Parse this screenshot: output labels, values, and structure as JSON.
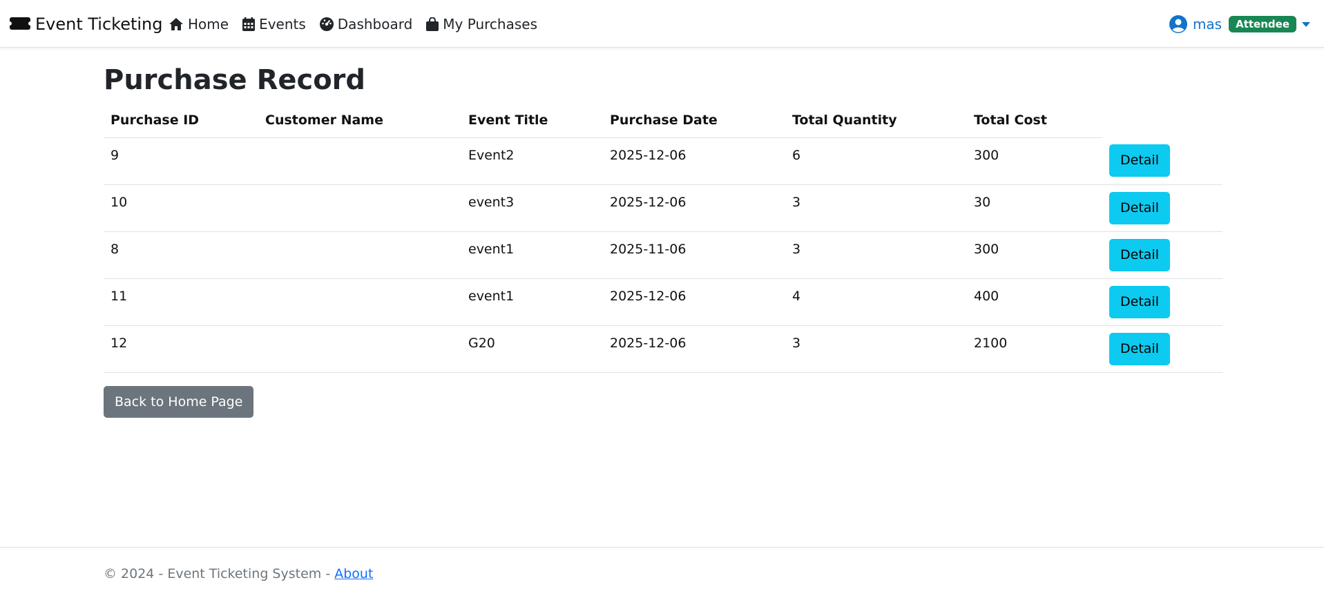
{
  "navbar": {
    "brand": "Event Ticketing",
    "links": [
      {
        "label": "Home",
        "icon": "house-icon"
      },
      {
        "label": "Events",
        "icon": "calendar-icon"
      },
      {
        "label": "Dashboard",
        "icon": "speedometer-icon"
      },
      {
        "label": "My Purchases",
        "icon": "shopping-bag-icon"
      }
    ],
    "user": {
      "name": "mas",
      "role_badge": "Attendee",
      "icon": "user-circle-icon"
    }
  },
  "main": {
    "title": "Purchase Record",
    "table": {
      "headers": [
        "Purchase ID",
        "Customer Name",
        "Event Title",
        "Purchase Date",
        "Total Quantity",
        "Total Cost"
      ],
      "action_label": "Detail",
      "rows": [
        {
          "id": "9",
          "customer": "",
          "event": "Event2",
          "date": "2025-12-06",
          "quantity": "6",
          "cost": "300"
        },
        {
          "id": "10",
          "customer": "",
          "event": "event3",
          "date": "2025-12-06",
          "quantity": "3",
          "cost": "30"
        },
        {
          "id": "8",
          "customer": "",
          "event": "event1",
          "date": "2025-11-06",
          "quantity": "3",
          "cost": "300"
        },
        {
          "id": "11",
          "customer": "",
          "event": "event1",
          "date": "2025-12-06",
          "quantity": "4",
          "cost": "400"
        },
        {
          "id": "12",
          "customer": "",
          "event": "G20",
          "date": "2025-12-06",
          "quantity": "3",
          "cost": "2100"
        }
      ]
    },
    "back_button": "Back to Home Page"
  },
  "footer": {
    "text": "© 2024 - Event Ticketing System - ",
    "link": "About"
  },
  "colors": {
    "primary_link": "#1273c9",
    "badge_success": "#198754",
    "info_button": "#0dcaf0",
    "secondary_button": "#6c757d"
  }
}
